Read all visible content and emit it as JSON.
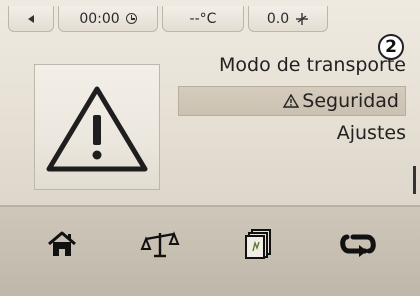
{
  "status_bar": {
    "clock": "00:00",
    "temperature": "--°C",
    "fan_speed": "0.0"
  },
  "badge": "2",
  "menu": {
    "items": [
      "Modo de transporte",
      "Seguridad",
      "Ajustes"
    ],
    "selected_index": 1
  },
  "icons": {
    "back": "back-arrow-icon",
    "clock": "clock-icon",
    "fan": "fan-icon",
    "warning": "warning-triangle-icon",
    "home": "home-icon",
    "scale": "balance-scale-icon",
    "cards": "cards-icon",
    "loop": "loop-arrows-icon"
  }
}
